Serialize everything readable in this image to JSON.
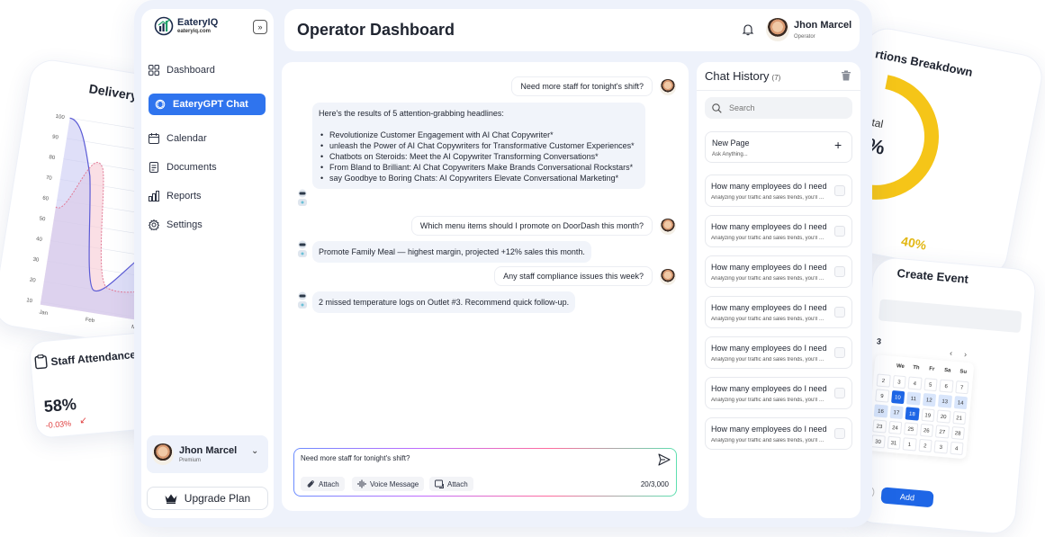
{
  "bg": {
    "delivery": {
      "title": "Delivery Per",
      "y_ticks": [
        "100",
        "90",
        "80",
        "70",
        "60",
        "50",
        "40",
        "30",
        "20",
        "10"
      ],
      "x_ticks": [
        "Jan",
        "Feb",
        "Mar"
      ]
    },
    "attendance": {
      "title": "Staff Attendance",
      "value": "58%",
      "delta": "-0.03%",
      "arrow": "↙"
    },
    "breakdown": {
      "title": "rtions Breakdown",
      "total_label": "otal",
      "total_value": "0%",
      "pct": "40%"
    },
    "event": {
      "title": "Create Event",
      "month": "3",
      "days_header": [
        "",
        "We",
        "Th",
        "Fr",
        "Sa",
        "Su"
      ],
      "days": [
        "2",
        "3",
        "4",
        "5",
        "6",
        "7",
        "9",
        "10",
        "11",
        "12",
        "13",
        "14",
        "16",
        "17",
        "18",
        "19",
        "20",
        "21",
        "23",
        "24",
        "25",
        "26",
        "27",
        "28",
        "30",
        "31",
        "1",
        "2",
        "3",
        "4"
      ],
      "add_label": "Add"
    }
  },
  "sidebar": {
    "logo_name": "EateryIQ",
    "logo_url": "eateryiq.com",
    "items": [
      {
        "label": "Dashboard",
        "icon": "grid-icon"
      },
      {
        "label": "EateryGPT Chat",
        "icon": "openai-icon"
      },
      {
        "label": "Calendar",
        "icon": "calendar-icon"
      },
      {
        "label": "Documents",
        "icon": "document-icon"
      },
      {
        "label": "Reports",
        "icon": "bar-chart-icon"
      },
      {
        "label": "Settings",
        "icon": "gear-icon"
      }
    ],
    "user": {
      "name": "Jhon Marcel",
      "plan": "Premium"
    },
    "upgrade_label": "Upgrade Plan"
  },
  "header": {
    "title": "Operator Dashboard",
    "user_name": "Jhon Marcel",
    "user_role": "Operator"
  },
  "chat": {
    "messages": [
      {
        "role": "user",
        "text": "Need more staff for tonight's shift?"
      },
      {
        "role": "bot",
        "intro": "Here's the results of 5 attention-grabbing headlines:",
        "bullets": [
          "Revolutionize Customer Engagement with AI Chat Copywriter*",
          "unleash the Power of AI Chat Copywriters for Transformative Customer Experiences*",
          "Chatbots on Steroids: Meet the AI Copywriter Transforming Conversations*",
          "From Bland to Brilliant: AI Chat Copywriters Make Brands Conversational Rockstars*",
          "say Goodbye to Boring Chats: AI Copywriters Elevate Conversational Marketing*"
        ]
      },
      {
        "role": "user",
        "text": "Which menu items should I promote on DoorDash this month?"
      },
      {
        "role": "bot",
        "text": "Promote Family Meal — highest margin, projected +12% sales this month."
      },
      {
        "role": "user",
        "text": "Any staff compliance issues this week?"
      },
      {
        "role": "bot",
        "text": "2 missed temperature logs on Outlet #3. Recommend quick follow-up."
      }
    ],
    "composer": {
      "value": "Need more staff for tonight's shift?",
      "attach1": "Attach",
      "voice": "Voice Message",
      "attach2": "Attach",
      "counter": "20/3,000"
    }
  },
  "history": {
    "title": "Chat History",
    "count": "(7)",
    "search_placeholder": "Search",
    "new_page": {
      "title": "New Page",
      "subtitle": "Ask Anything..."
    },
    "items": [
      {
        "title": "How many employees do I need",
        "subtitle": "Analyzing your traffic and sales trends, you'll need"
      },
      {
        "title": "How many employees do I need",
        "subtitle": "Analyzing your traffic and sales trends, you'll need"
      },
      {
        "title": "How many employees do I need",
        "subtitle": "Analyzing your traffic and sales trends, you'll need"
      },
      {
        "title": "How many employees do I need",
        "subtitle": "Analyzing your traffic and sales trends, you'll need"
      },
      {
        "title": "How many employees do I need",
        "subtitle": "Analyzing your traffic and sales trends, you'll need"
      },
      {
        "title": "How many employees do I need",
        "subtitle": "Analyzing your traffic and sales trends, you'll need"
      },
      {
        "title": "How many employees do I need",
        "subtitle": "Analyzing your traffic and sales trends, you'll need"
      }
    ]
  },
  "colors": {
    "accent": "#2f74ee",
    "donut_blue": "#3b82f6",
    "donut_yellow": "#f5c518",
    "delta_red": "#e04040"
  }
}
